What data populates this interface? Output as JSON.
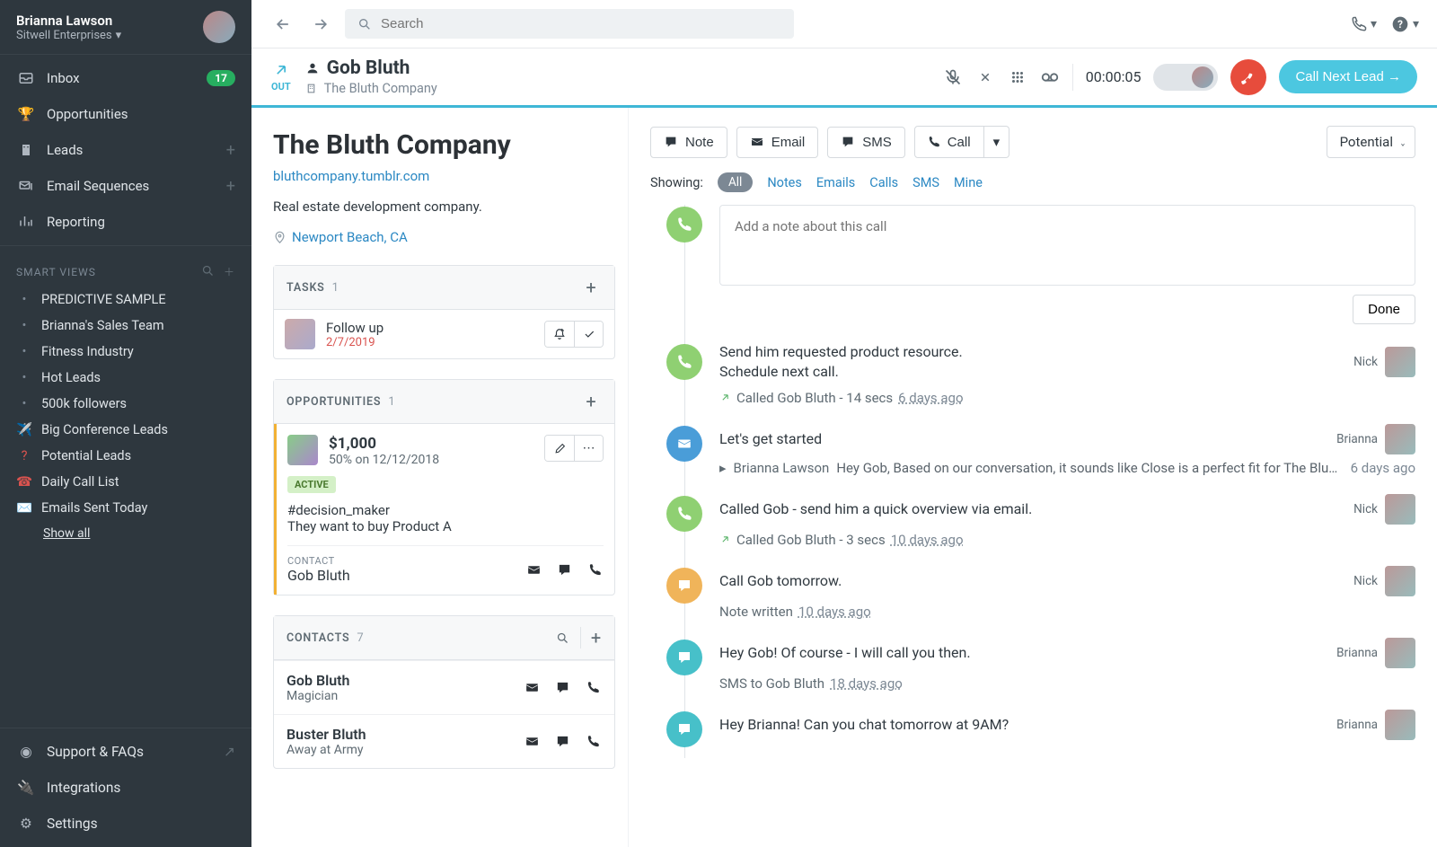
{
  "user": {
    "name": "Brianna Lawson",
    "org": "Sitwell Enterprises"
  },
  "nav": {
    "inbox": "Inbox",
    "inbox_count": "17",
    "opportunities": "Opportunities",
    "leads": "Leads",
    "email_sequences": "Email Sequences",
    "reporting": "Reporting"
  },
  "smart_views": {
    "header": "SMART VIEWS",
    "items": [
      {
        "icon": "•",
        "label": "PREDICTIVE SAMPLE"
      },
      {
        "icon": "•",
        "label": "Brianna's Sales Team"
      },
      {
        "icon": "•",
        "label": "Fitness Industry"
      },
      {
        "icon": "•",
        "label": "Hot Leads"
      },
      {
        "icon": "•",
        "label": "500k followers"
      },
      {
        "icon": "✈️",
        "label": "Big Conference Leads"
      },
      {
        "icon": "❓",
        "label": "Potential Leads"
      },
      {
        "icon": "📞",
        "label": "Daily Call List"
      },
      {
        "icon": "✉️",
        "label": "Emails Sent Today"
      }
    ],
    "show_all": "Show all"
  },
  "footer": {
    "support": "Support & FAQs",
    "integrations": "Integrations",
    "settings": "Settings"
  },
  "search": {
    "placeholder": "Search"
  },
  "call": {
    "out": "OUT",
    "contact": "Gob Bluth",
    "company": "The Bluth Company",
    "timer": "00:00:05",
    "next": "Call Next Lead →"
  },
  "lead": {
    "name": "The Bluth Company",
    "url": "bluthcompany.tumblr.com",
    "desc": "Real estate development company.",
    "location": "Newport Beach, CA",
    "status": "Potential"
  },
  "tasks": {
    "title": "TASKS",
    "count": "1",
    "items": [
      {
        "title": "Follow up",
        "date": "2/7/2019"
      }
    ]
  },
  "opps": {
    "title": "OPPORTUNITIES",
    "count": "1",
    "item": {
      "amount": "$1,000",
      "sub": "50% on 12/12/2018",
      "badge": "ACTIVE",
      "hashtag": "#decision_maker",
      "text": "They want to buy Product A",
      "contact_label": "CONTACT",
      "contact": "Gob Bluth"
    }
  },
  "contacts": {
    "title": "CONTACTS",
    "count": "7",
    "items": [
      {
        "name": "Gob Bluth",
        "role": "Magician"
      },
      {
        "name": "Buster Bluth",
        "role": "Away at Army"
      }
    ]
  },
  "actions": {
    "note": "Note",
    "email": "Email",
    "sms": "SMS",
    "call": "Call"
  },
  "filter": {
    "label": "Showing:",
    "all": "All",
    "notes": "Notes",
    "emails": "Emails",
    "calls": "Calls",
    "sms": "SMS",
    "mine": "Mine"
  },
  "activity": {
    "note_placeholder": "Add a note about this call",
    "done": "Done",
    "items": [
      {
        "type": "call",
        "body": "Send him requested product resource.\nSchedule next call.",
        "author": "Nick",
        "sub": "Called Gob Bluth - 14 secs",
        "time": "6 days ago"
      },
      {
        "type": "email",
        "body": "Let's get started",
        "author": "Brianna",
        "preview_sender": "Brianna Lawson",
        "preview": "Hey Gob, Based on our conversation, it sounds like Close is a perfect fit for The Blut...",
        "time_right": "6 days ago"
      },
      {
        "type": "call",
        "body": "Called Gob - send him a quick overview via email.",
        "author": "Nick",
        "sub": "Called Gob Bluth - 3 secs",
        "time": "10 days ago"
      },
      {
        "type": "chat",
        "body": "Call Gob tomorrow.",
        "author": "Nick",
        "sub": "Note written",
        "time": "10 days ago"
      },
      {
        "type": "sms",
        "body": "Hey Gob! Of course - I will call you then.",
        "author": "Brianna",
        "sub": "SMS to Gob Bluth",
        "time": "18 days ago"
      },
      {
        "type": "sms",
        "body": "Hey Brianna! Can you chat tomorrow at 9AM?",
        "author": "Brianna"
      }
    ]
  }
}
